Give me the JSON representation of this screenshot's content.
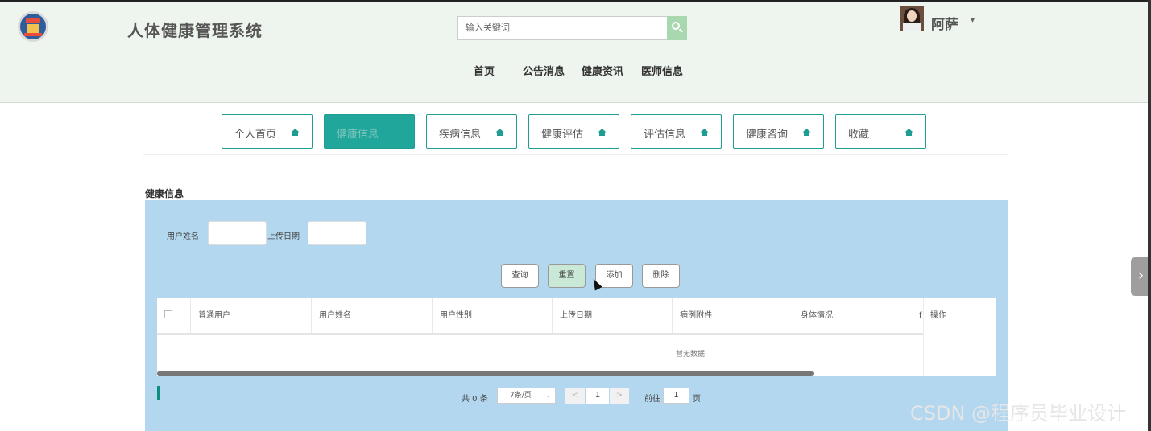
{
  "header": {
    "site_title": "人体健康管理系统",
    "search_placeholder": "输入关键词",
    "username": "阿萨",
    "user_caret": "▾",
    "nav": [
      "首页",
      "公告消息",
      "健康资讯",
      "医师信息"
    ]
  },
  "tabs": [
    {
      "label": "个人首页",
      "active": false
    },
    {
      "label": "健康信息",
      "active": true
    },
    {
      "label": "疾病信息",
      "active": false
    },
    {
      "label": "健康评估",
      "active": false
    },
    {
      "label": "评估信息",
      "active": false
    },
    {
      "label": "健康咨询",
      "active": false
    },
    {
      "label": "收藏",
      "active": false
    }
  ],
  "section_title": "健康信息",
  "filters": {
    "user_name_label": "用户姓名",
    "upload_date_label": "上传日期"
  },
  "actions": {
    "query": "查询",
    "reset": "重置",
    "add": "添加",
    "delete": "删除"
  },
  "table": {
    "columns": [
      "普通用户",
      "用户姓名",
      "用户性别",
      "上传日期",
      "病例附件",
      "身体情况"
    ],
    "truncated_col": "f",
    "op_col": "操作",
    "empty_text": "暂无数据"
  },
  "pager": {
    "total": "共 0 条",
    "page_size": "7条/页",
    "prev": "<",
    "current": "1",
    "next": ">",
    "goto_label": "前往",
    "goto_value": "1",
    "page_unit": "页"
  },
  "side_tab_glyph": "›",
  "watermark": "CSDN @程序员毕业设计",
  "colors": {
    "accent": "#20a69b",
    "panel": "#b3d7ef",
    "header_bg": "#eef4ee"
  }
}
